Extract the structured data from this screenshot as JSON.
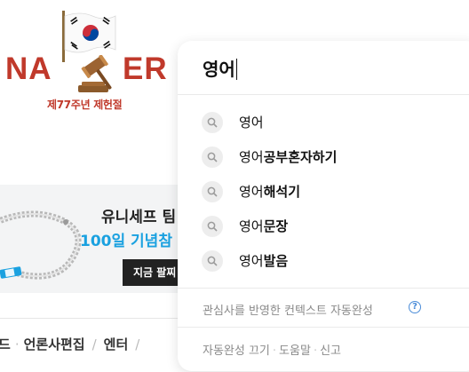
{
  "logo": {
    "text_left": "NA",
    "text_right": "ER",
    "subtitle": "제77주년 제헌절",
    "colors": {
      "brand": "#c0392b",
      "flag_red": "#cd2e3a",
      "flag_blue": "#0047a0"
    }
  },
  "banner": {
    "title": "유니세프 팀",
    "subtitle": "100일 기념참",
    "button_label": "지금 팔찌",
    "accent": "#1aa1e0"
  },
  "bottom_nav": {
    "items": [
      "드",
      "언론사편집",
      "엔터"
    ]
  },
  "autocomplete": {
    "query": "영어",
    "suggestions": [
      {
        "prefix": "영어",
        "suffix": ""
      },
      {
        "prefix": "영어",
        "suffix": "공부혼자하기"
      },
      {
        "prefix": "영어",
        "suffix": "해석기"
      },
      {
        "prefix": "영어",
        "suffix": "문장"
      },
      {
        "prefix": "영어",
        "suffix": "발음"
      }
    ],
    "context_label": "관심사를 반영한 컨텍스트 자동완성",
    "help_icon": "?",
    "footer": {
      "turn_off": "자동완성 끄기",
      "help": "도움말",
      "report": "신고"
    }
  }
}
